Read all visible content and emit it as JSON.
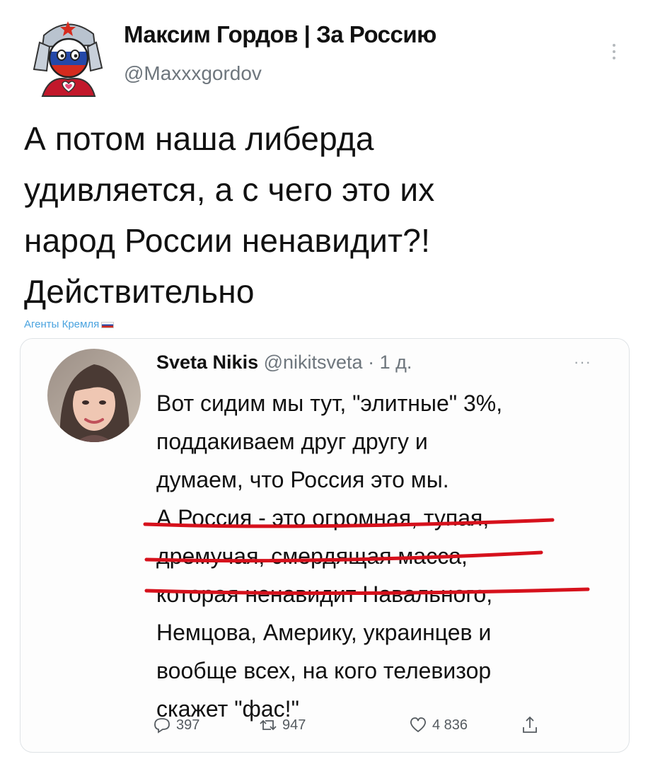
{
  "tweet": {
    "author_name": "Максим Гордов | За Россию",
    "author_handle": "@Maxxxgordov",
    "text_lines": [
      "А потом наша либерда",
      "удивляется, а с чего это их",
      "народ России ненавидит?!",
      "Действительно"
    ],
    "source_label": "Агенты Кремля"
  },
  "quoted": {
    "author_name": "Sveta Nikis",
    "author_handle": "@nikitsveta",
    "separator": "·",
    "time": "1 д.",
    "more_label": "···",
    "text_lines": [
      "Вот сидим мы тут, \"элитные\" 3%,",
      "поддакиваем друг другу и",
      "думаем, что Россия это мы.",
      "А Россия - это огромная, тупая,",
      "дремучая, смердящая масса,",
      "которая ненавидит Навального,",
      "Немцова, Америку, украинцев и",
      "вообще всех, на кого телевизор",
      "скажет \"фас!\""
    ],
    "replies": "397",
    "retweets": "947",
    "likes": "4 836"
  },
  "colors": {
    "text": "#111111",
    "handle": "#6e767d",
    "source_link": "#4aa3df",
    "underline": "#d6111c",
    "card_border": "#dfe3e6"
  }
}
